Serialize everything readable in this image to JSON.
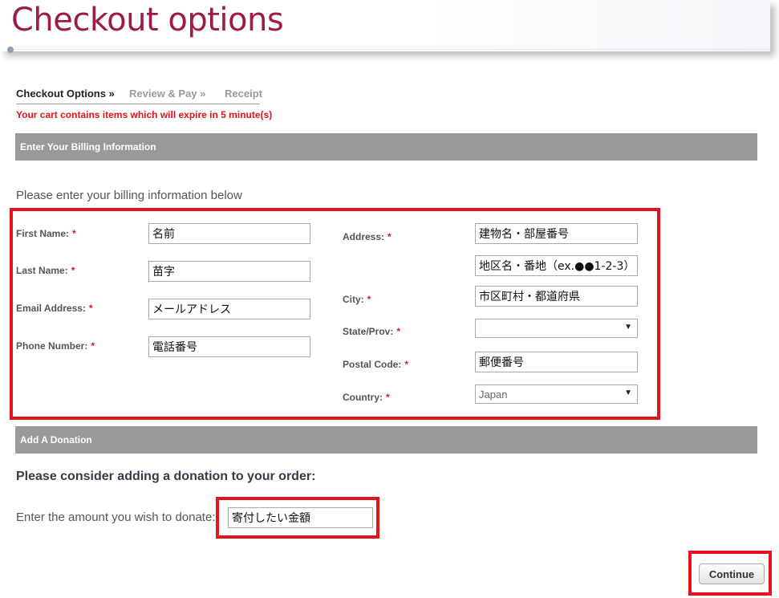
{
  "page": {
    "title": "Checkout options"
  },
  "breadcrumb": [
    {
      "label": "Checkout Options »",
      "active": true
    },
    {
      "label": "Review & Pay »",
      "active": false
    },
    {
      "label": "Receipt",
      "active": false
    }
  ],
  "cart_warning": "Your cart contains items which will expire in 5 minute(s)",
  "billing": {
    "section_title": "Enter Your Billing Information",
    "intro": "Please enter your billing information below",
    "required_marker": "*",
    "fields": {
      "first_name": {
        "label": "First Name:",
        "value": "名前"
      },
      "last_name": {
        "label": "Last Name:",
        "value": "苗字"
      },
      "email": {
        "label": "Email Address:",
        "value": "メールアドレス"
      },
      "phone": {
        "label": "Phone Number:",
        "value": "電話番号"
      },
      "address": {
        "label": "Address:",
        "value": "建物名・部屋番号"
      },
      "address2": {
        "value": "地区名・番地（ex.●●1-2-3）"
      },
      "city": {
        "label": "City:",
        "value": "市区町村・都道府県"
      },
      "state": {
        "label": "State/Prov:",
        "value": ""
      },
      "postal": {
        "label": "Postal Code:",
        "value": "郵便番号"
      },
      "country": {
        "label": "Country:",
        "value": "Japan"
      }
    }
  },
  "donation": {
    "section_title": "Add A Donation",
    "heading": "Please consider adding a donation to your order:",
    "amount_label": "Enter the amount you wish to donate:",
    "amount_value": "寄付したい金額"
  },
  "actions": {
    "continue_label": "Continue"
  },
  "colors": {
    "title": "#9b1d47",
    "warning": "#e0141e",
    "section_bar": "#999999",
    "highlight": "#e3141e"
  },
  "icons": {
    "dropdown": "triangle-down"
  }
}
